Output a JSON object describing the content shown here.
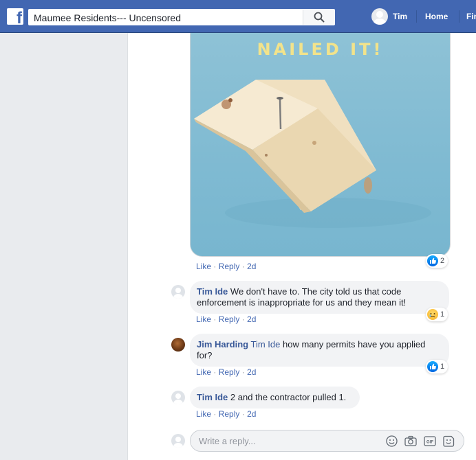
{
  "header": {
    "search_value": "Maumee Residents--- Uncensored",
    "user_name": "Tim",
    "nav": [
      "Home",
      "Fin"
    ]
  },
  "gif": {
    "caption": "NAILED IT!"
  },
  "post_actions": {
    "like": "Like",
    "reply": "Reply",
    "time": "2d"
  },
  "post_reaction": {
    "type": "like",
    "count": "2"
  },
  "comments": [
    {
      "author": "Tim Ide",
      "mention": "",
      "text": "We don't have to. The city told us that code",
      "text2": "enforcement is inappropriate for us and they mean it!",
      "like": "Like",
      "reply": "Reply",
      "time": "2d",
      "reaction": {
        "type": "sad",
        "count": "1"
      }
    },
    {
      "author": "Jim Harding",
      "mention": "Tim Ide",
      "text": "how many permits have you applied",
      "text2": "for?",
      "like": "Like",
      "reply": "Reply",
      "time": "2d",
      "reaction": {
        "type": "like",
        "count": "1"
      }
    },
    {
      "author": "Tim Ide",
      "mention": "",
      "text": "2 and the contractor pulled 1.",
      "like": "Like",
      "reply": "Reply",
      "time": "2d"
    }
  ],
  "reply_box": {
    "placeholder": "Write a reply..."
  }
}
